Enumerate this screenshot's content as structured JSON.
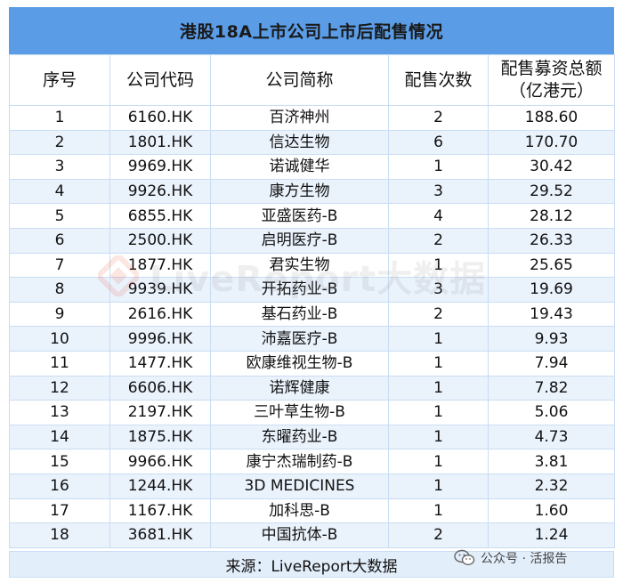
{
  "title": "港股18A上市公司上市后配售情况",
  "headers": {
    "rank": "序号",
    "code": "公司代码",
    "name": "公司简称",
    "count": "配售次数",
    "amount_line1": "配售募资总额",
    "amount_line2": "（亿港元）"
  },
  "rows": [
    {
      "rank": "1",
      "code": "6160.HK",
      "name": "百济神州",
      "count": "2",
      "amount": "188.60"
    },
    {
      "rank": "2",
      "code": "1801.HK",
      "name": "信达生物",
      "count": "6",
      "amount": "170.70"
    },
    {
      "rank": "3",
      "code": "9969.HK",
      "name": "诺诚健华",
      "count": "1",
      "amount": "30.42"
    },
    {
      "rank": "4",
      "code": "9926.HK",
      "name": "康方生物",
      "count": "3",
      "amount": "29.52"
    },
    {
      "rank": "5",
      "code": "6855.HK",
      "name": "亚盛医药-B",
      "count": "4",
      "amount": "28.12"
    },
    {
      "rank": "6",
      "code": "2500.HK",
      "name": "启明医疗-B",
      "count": "2",
      "amount": "26.33"
    },
    {
      "rank": "7",
      "code": "1877.HK",
      "name": "君实生物",
      "count": "1",
      "amount": "25.65"
    },
    {
      "rank": "8",
      "code": "9939.HK",
      "name": "开拓药业-B",
      "count": "3",
      "amount": "19.69"
    },
    {
      "rank": "9",
      "code": "2616.HK",
      "name": "基石药业-B",
      "count": "2",
      "amount": "19.43"
    },
    {
      "rank": "10",
      "code": "9996.HK",
      "name": "沛嘉医疗-B",
      "count": "1",
      "amount": "9.93"
    },
    {
      "rank": "11",
      "code": "1477.HK",
      "name": "欧康维视生物-B",
      "count": "1",
      "amount": "7.94"
    },
    {
      "rank": "12",
      "code": "6606.HK",
      "name": "诺辉健康",
      "count": "1",
      "amount": "7.82"
    },
    {
      "rank": "13",
      "code": "2197.HK",
      "name": "三叶草生物-B",
      "count": "1",
      "amount": "5.06"
    },
    {
      "rank": "14",
      "code": "1875.HK",
      "name": "东曜药业-B",
      "count": "1",
      "amount": "4.73"
    },
    {
      "rank": "15",
      "code": "9966.HK",
      "name": "康宁杰瑞制药-B",
      "count": "1",
      "amount": "3.81"
    },
    {
      "rank": "16",
      "code": "1244.HK",
      "name": "3D MEDICINES",
      "count": "1",
      "amount": "2.32"
    },
    {
      "rank": "17",
      "code": "1167.HK",
      "name": "加科思-B",
      "count": "1",
      "amount": "1.60"
    },
    {
      "rank": "18",
      "code": "3681.HK",
      "name": "中国抗体-B",
      "count": "2",
      "amount": "1.24"
    }
  ],
  "footer": "来源：LiveReport大数据",
  "watermark": "LiveReport大数据",
  "wechat_label": "公众号 · 活报告",
  "colors": {
    "title_bg": "#5a9ce6",
    "row_alt_bg": "#eaf2fc",
    "footer_bg": "#e3eefb",
    "border": "#c9ddf3",
    "watermark_accent": "#e8452c"
  },
  "icons": {
    "watermark_logo": "livereport-logo-icon",
    "wechat": "wechat-icon"
  }
}
